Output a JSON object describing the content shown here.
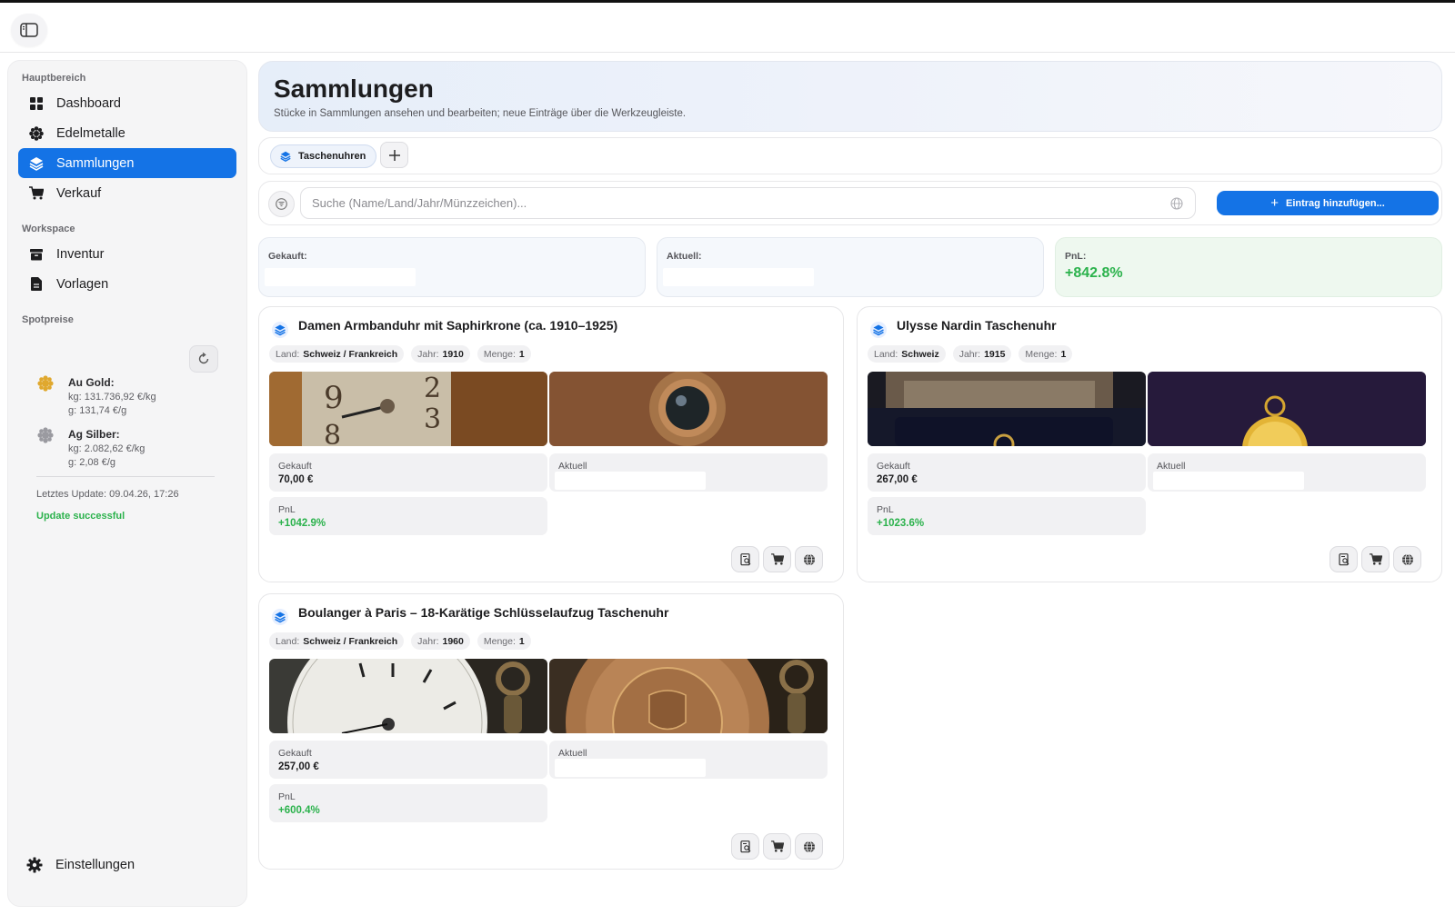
{
  "sidebar": {
    "section_main": "Hauptbereich",
    "items_main": [
      {
        "label": "Dashboard",
        "icon": "grid-icon"
      },
      {
        "label": "Edelmetalle",
        "icon": "nugget-icon"
      },
      {
        "label": "Sammlungen",
        "icon": "layers-icon",
        "active": true
      },
      {
        "label": "Verkauf",
        "icon": "cart-icon"
      }
    ],
    "section_workspace": "Workspace",
    "items_workspace": [
      {
        "label": "Inventur",
        "icon": "archive-icon"
      },
      {
        "label": "Vorlagen",
        "icon": "document-icon"
      }
    ],
    "section_spot": "Spotpreise",
    "gold": {
      "name": "Au Gold:",
      "kg": "kg: 131.736,92 €/kg",
      "g": "g: 131,74 €/g",
      "color": "#e0a82e"
    },
    "silver": {
      "name": "Ag Silber:",
      "kg": "kg: 2.082,62 €/kg",
      "g": "g: 2,08 €/g",
      "color": "#9a9aa0"
    },
    "last_update": "Letztes Update: 09.04.26, 17:26",
    "update_status": "Update successful",
    "settings_label": "Einstellungen"
  },
  "header": {
    "title": "Sammlungen",
    "subtitle": "Stücke in Sammlungen ansehen und bearbeiten; neue Einträge über die Werkzeugleiste."
  },
  "tabs": [
    {
      "label": "Taschenuhren"
    }
  ],
  "search": {
    "placeholder": "Suche (Name/Land/Jahr/Münzzeichen)...",
    "add_label": "Eintrag hinzufügen..."
  },
  "stats": {
    "bought_label": "Gekauft:",
    "current_label": "Aktuell:",
    "pnl_label": "PnL:",
    "pnl_value": "+842.8%"
  },
  "labels": {
    "land": "Land:",
    "year": "Jahr:",
    "qty": "Menge:",
    "bought": "Gekauft",
    "current": "Aktuell",
    "pnl": "PnL"
  },
  "items": [
    {
      "title": "Damen Armbanduhr mit Saphirkrone (ca. 1910–1925)",
      "land": "Schweiz / Frankreich",
      "year": "1910",
      "qty": "1",
      "bought": "70,00 €",
      "pnl": "+1042.9%"
    },
    {
      "title": "Ulysse Nardin Taschenuhr",
      "land": "Schweiz",
      "year": "1915",
      "qty": "1",
      "bought": "267,00 €",
      "pnl": "+1023.6%"
    },
    {
      "title": "Boulanger à Paris – 18-Karätige Schlüsselaufzug Taschenuhr",
      "land": "Schweiz / Frankreich",
      "year": "1960",
      "qty": "1",
      "bought": "257,00 €",
      "pnl": "+600.4%"
    }
  ],
  "colors": {
    "accent": "#1473e6",
    "positive": "#2bb24c"
  }
}
